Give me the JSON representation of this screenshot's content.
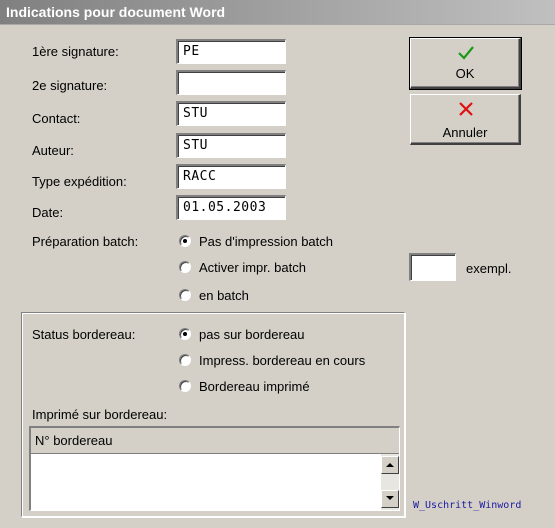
{
  "window": {
    "title": "Indications pour document Word"
  },
  "fields": [
    {
      "label": "1ère signature:",
      "value": "PE"
    },
    {
      "label": "2e signature:",
      "value": ""
    },
    {
      "label": "Contact:",
      "value": "STU"
    },
    {
      "label": "Auteur:",
      "value": "STU"
    },
    {
      "label": "Type expédition:",
      "value": "RACC"
    },
    {
      "label": "Date:",
      "value": "01.05.2003"
    }
  ],
  "buttons": {
    "ok": {
      "label": "OK",
      "icon": "check-icon",
      "color": "#1a9a1a"
    },
    "cancel": {
      "label": "Annuler",
      "icon": "x-icon",
      "color": "#e01010"
    }
  },
  "batch": {
    "label": "Préparation batch:",
    "options": [
      "Pas d'impression batch",
      "Activer impr. batch",
      "en batch"
    ],
    "selected": 0,
    "copies_value": "",
    "copies_label": "exempl."
  },
  "bordereau": {
    "status_label": "Status bordereau:",
    "options": [
      "pas sur bordereau",
      "Impress. bordereau en cours",
      "Bordereau imprimé"
    ],
    "selected": 0,
    "printed_label": "Imprimé sur bordereau:",
    "column_header": "N° bordereau",
    "rows": []
  },
  "footer": {
    "text": "W_Uschritt_Winword"
  }
}
